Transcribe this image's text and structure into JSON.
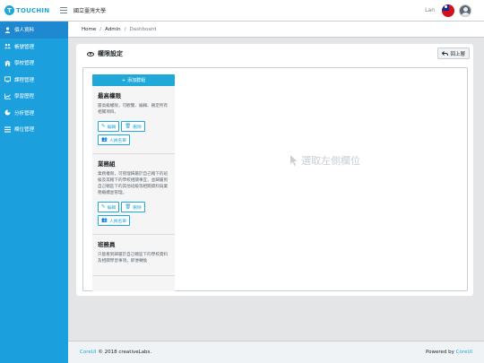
{
  "header": {
    "brand_letter": "T",
    "brand_text": "TOUCHIN",
    "school": "國立臺灣大學",
    "user_name": "Lan"
  },
  "sidebar": {
    "items": [
      {
        "icon": "user-icon",
        "label": "個人資料",
        "active": true
      },
      {
        "icon": "users-icon",
        "label": "帳號管理",
        "active": false
      },
      {
        "icon": "school-icon",
        "label": "學校管理",
        "active": false
      },
      {
        "icon": "course-icon",
        "label": "課程管理",
        "active": false
      },
      {
        "icon": "chart-line-icon",
        "label": "學習歷程",
        "active": false
      },
      {
        "icon": "pie-chart-icon",
        "label": "分析管理",
        "active": false
      },
      {
        "icon": "list-icon",
        "label": "欄位管理",
        "active": false
      }
    ]
  },
  "breadcrumb": {
    "home": "Home",
    "admin": "Admin",
    "current": "Dashboard",
    "separator": "/"
  },
  "card": {
    "title": "權限設定",
    "back_label": "回上層",
    "add_label": "添加群組",
    "placeholder": "選取左側欄位",
    "groups": [
      {
        "title": "最高權限",
        "desc": "最高級權限，可觀覽、編輯、刪定所有相關項目。",
        "edit": "編輯",
        "delete": "刪除",
        "members": "人員名單"
      },
      {
        "title": "業務組",
        "desc": "業務權限，可管理歸屬於自己轄下的班級及其轄下的學校相關事宜，並歸屬到自己轄區下的其他班級等相關資料與業務繼續並管理。",
        "edit": "編輯",
        "delete": "刪除",
        "members": "人員名單"
      },
      {
        "title": "班務員",
        "desc": "只能看到歸屬於自己轄區下的學校資料及相關學習事項，即便轉換",
        "edit": "",
        "delete": "",
        "members": ""
      }
    ]
  },
  "footer": {
    "brand": "CoreUI",
    "copyright": "© 2018 creativeLabs.",
    "powered_prefix": "Powered by",
    "powered_link": "CoreUI"
  },
  "colors": {
    "primary": "#20a8d8",
    "sidebar": "#1ba0dd",
    "sidebar_active": "#1e88d0",
    "page_bg": "#e4e5e6"
  }
}
